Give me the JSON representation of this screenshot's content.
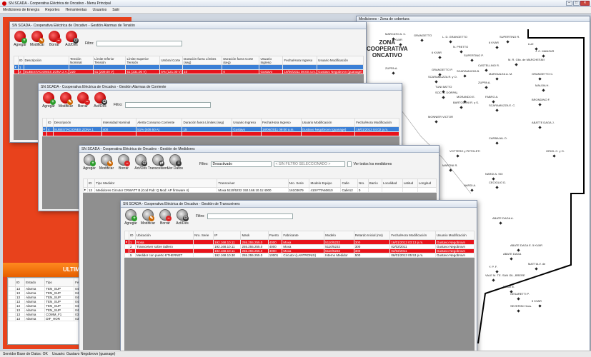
{
  "main": {
    "title": "SN SCADA - Cooperativa Eléctrica de Oncativo - Menu Principal",
    "menu": [
      "Mediciones de Energía",
      "Reportes",
      "Herramientas",
      "Usuarios",
      "Salir"
    ],
    "status": [
      "Servidor Base de Datos: OK",
      "Usuario: Gustavo Negobrovn (guanage)"
    ]
  },
  "map": {
    "title": "Mediciones - Zona de cobertura",
    "zone": "ZONA\nCOOPERATIVA\nONCATIVO",
    "labels": [
      "MARCATO A. C.",
      "5 KVAR",
      "GRANGETTO",
      "L. D. GRANGETTO",
      "SUPERTINO R.",
      "LUZ",
      "6 KVAR",
      "J. C. MANZUR",
      "N. PRETTO",
      "6 KVAR",
      "SUPERTINO P.",
      "M. R. Gllo. de MARCHESINI",
      "CASTELLINO R.",
      "ZUPPA A.",
      "GRANGETTO P.",
      "SCARAMUZZA B.",
      "MARGIALEA A. M.",
      "ZUPPA A.",
      "GRANGETTO C.",
      "SCARAMUZZA R. y O.",
      "MAUJIA H.",
      "TUNI BATTO",
      "SOC. A. DORPAL",
      "MORANDO E.",
      "FABRO A.",
      "BARTOLONI R. y S.",
      "SCARAMUZZA E. C.",
      "BRONDINO F.",
      "MONNIER VICTOR",
      "ABATTE DAGA J.",
      "CARBAJAL O.",
      "VOTTERO y PETOLETI",
      "ORIOL C. y O.",
      "MARTINI R.",
      "NARDI A. SIX",
      "NARDI A.",
      "CECIGLIO D.",
      "ABATE DAGA A.",
      "ABATE DAGA E. 5 KVAR",
      "ABATE DAGA",
      "MATTIA V. de",
      "Y. P. F.",
      "VALE M. TE. SAN GIL, BRERE",
      "VIALE E.",
      "CESARETTI P.",
      "SEVERINI Hnos.",
      "5 KVAR"
    ]
  },
  "w1": {
    "title": "SN SCADA - Cooperativa Eléctrica de Oncativo - Gestión Alarmas de Tensión",
    "toolbar": [
      "Agregar",
      "Modificar",
      "Borrar",
      "Act/Des"
    ],
    "filter_label": "Filtro:",
    "cols": [
      "ID",
      "Descripción",
      "Tensión Nominal",
      "Límite Inferior Tensión",
      "Límite Superior Tensión",
      "Umbral Corte",
      "Duración fuera Límites (seg)",
      "Duración fuera Corte (seg)",
      "Usuario Ingreso",
      "Fecha/Hora Ingreso",
      "Usuario Modificación"
    ],
    "rows": [
      [
        "1",
        "",
        "",
        "",
        "",
        "",
        "",
        "",
        "",
        "",
        ""
      ],
      [
        "3",
        "SUBESTACIONES ZONA 2 A.",
        "220",
        "51 (209.00 V)",
        "51 (231.00 V)",
        "5% (121.00 V)",
        "10",
        "0",
        "Gustavo",
        "19/06/2011 08:00 a.m.",
        "Gustavo Negobrovn (guanage)"
      ]
    ],
    "filter_label2": "Filtro:"
  },
  "w2": {
    "title": "SN SCADA - Cooperativa Eléctrica de Oncativo - Gestión Alarmas de Corriente",
    "toolbar": [
      "Agregar",
      "Modificar",
      "Borrar",
      "Act/Des"
    ],
    "filter_label": "Filtro:",
    "cols": [
      "ID",
      "Descripción",
      "Intensidad Nominal",
      "Alerta Consumo Corriente",
      "Duración fuera Límites (seg)",
      "Usuario Ingreso",
      "Fecha/Hora Ingreso",
      "Usuario Modificación",
      "Fecha/Hora Modificación"
    ],
    "rows": [
      [
        "4",
        "SUBESTACIONES ZONA 1",
        "400",
        "51% (409.50 A)",
        "15",
        "Gustavo",
        "18/06/2011 09:00 a.m.",
        "Gustavo Negobrovn (guanage)",
        "16/01/2013 04:02 p.m."
      ],
      [
        "",
        "",
        "",
        "",
        "",
        "",
        "",
        "",
        ""
      ]
    ]
  },
  "w3": {
    "title": "SN SCADA - Cooperativa Eléctrica de Oncativo - Gestión de Medidores",
    "toolbar": [
      "Agregar",
      "Modificar",
      "Borrar",
      "Act/Des",
      "Transceivers",
      "Ver Datos"
    ],
    "filter_label": "Filtro:",
    "filter_value": "Desactivado",
    "filter_select": "< SIN FILTRO SELECCIONADO >",
    "filter_check": "Ver todos los medidores",
    "cols": [
      "ID",
      "Tipo Medidor",
      "Transceiver",
      "Nro. Serie",
      "Modelo Equipo",
      "Calle",
      "Nro.",
      "Barrio",
      "Localidad",
      "Latitud",
      "Longitud"
    ],
    "rows": [
      [
        "13",
        "Medidores Circutor CRWATT B (Cod Fab: Q Mod: AP firmware 4)",
        "Moxa 5110/5232 192.168.10.11:4000",
        "16103679",
        "410VTTA60610",
        "Calle12",
        "0",
        "",
        "",
        "",
        ""
      ]
    ]
  },
  "w4": {
    "title": "SN SCADA - Cooperativa Eléctrica de Oncativo - Gestión de Transceivers",
    "toolbar": [
      "Agregar",
      "Modificar",
      "Borrar",
      "Act/Des"
    ],
    "filter_label": "Filtro:",
    "cols": [
      "ID",
      "Ubicación",
      "Nro. Serie",
      "IP",
      "Mask",
      "Puerto",
      "Fabricante",
      "Modelo",
      "Retardo Inicial (ms)",
      "Fecha/Hora Modificación",
      "Usuario Modificación"
    ],
    "rows": [
      [
        "1",
        "Rosa",
        "",
        "192.168.10.11",
        "255.255.255.0",
        "4000",
        "Moxa",
        "5110/5232",
        "300",
        "16/01/2013 03:13 p.m.",
        "Gustavo Negobrovn"
      ],
      [
        "2",
        "Transceiver sobre tablero",
        "",
        "192.168.10.11",
        "255.255.255.0",
        "4000",
        "Moxa",
        "5110/5232",
        "300",
        "02/02/2011",
        "Gustavo Negobrovn"
      ],
      [
        "3",
        "",
        "",
        "192.168.10.11",
        "255.255.255.0",
        "4000",
        "Moxa",
        "5110/5232",
        "300",
        "02/02/2011",
        "Gustavo Negobrovn"
      ],
      [
        "5",
        "Medidor con puerto ETHERNET",
        "",
        "192.168.10.30",
        "255.255.255.0",
        "10001",
        "Circutor (LANTRONIX)",
        "Interno Medidor",
        "500",
        "06/01/2013 05:53 p.m.",
        "Gustavo Negobrovn"
      ]
    ]
  },
  "alarms": {
    "title": "ULTIMAS ALARMAS",
    "cols": [
      "ID",
      "Estado",
      "Tipo",
      "Fecha/Hora Evento"
    ],
    "rows": [
      [
        "13",
        "Alarma",
        "TEN_SUP",
        "04/02-2013"
      ],
      [
        "13",
        "Alarma",
        "TEN_SUP",
        "04/02-2013"
      ],
      [
        "13",
        "Alarma",
        "TEN_SUP",
        "04/02-2013"
      ],
      [
        "13",
        "Alarma",
        "TEN_SUP",
        "04/02-2013"
      ],
      [
        "13",
        "Alarma",
        "TEN_SUP",
        "04/02-2013"
      ],
      [
        "13",
        "Alarma",
        "TEN_SUP",
        "04/02-2013 06:43 a.m."
      ],
      [
        "13",
        "Alarma",
        "COMM_F1",
        "03/02/2013 11:46 a.m."
      ],
      [
        "13",
        "Alarma",
        "DIF_HOR",
        "03/02/2013 11:46 a.m."
      ]
    ]
  }
}
